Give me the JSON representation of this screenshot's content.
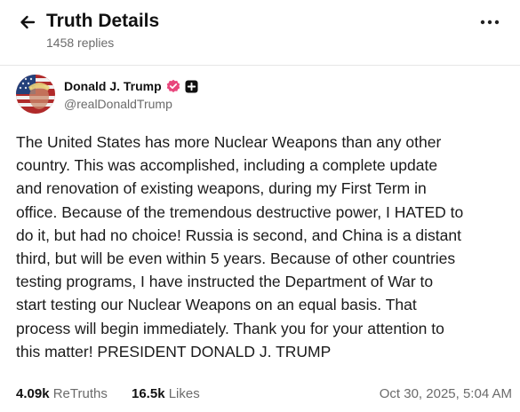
{
  "header": {
    "title": "Truth Details",
    "replies": "1458 replies",
    "back_icon": "arrow-left-icon",
    "more_icon": "more-horizontal-icon"
  },
  "author": {
    "name": "Donald J. Trump",
    "handle": "@realDonaldTrump",
    "verified_color": "#e8467c"
  },
  "post": {
    "text": "The United States has more Nuclear Weapons than any other\ncountry. This was accomplished, including a complete update\nand renovation of existing weapons, during my First Term in\noffice. Because of the tremendous destructive power, I HATED to\ndo it, but had no choice! Russia is second, and China is a distant\nthird, but will be even within 5 years. Because of other countries\ntesting programs, I have instructed the Department of War to\nstart testing our Nuclear Weapons on an equal basis. That\nprocess will begin immediately. Thank you for your attention to\nthis matter! PRESIDENT DONALD J. TRUMP"
  },
  "stats": {
    "retruths_count": "4.09k",
    "retruths_label": "ReTruths",
    "likes_count": "16.5k",
    "likes_label": "Likes",
    "timestamp": "Oct 30, 2025, 5:04 AM"
  }
}
